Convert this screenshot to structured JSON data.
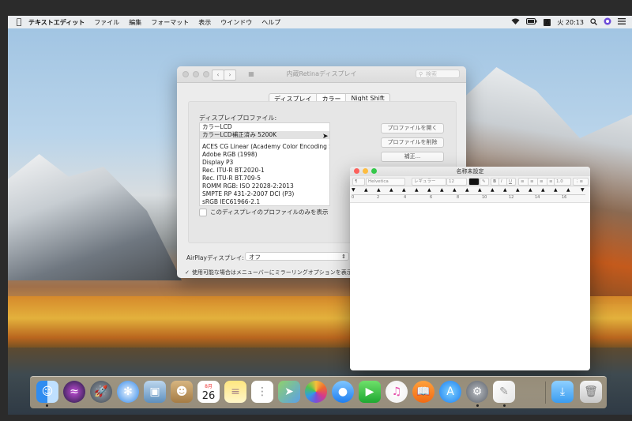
{
  "menubar": {
    "app_name": "テキストエディット",
    "items": [
      "ファイル",
      "編集",
      "フォーマット",
      "表示",
      "ウインドウ",
      "ヘルプ"
    ],
    "clock": "火 20:13",
    "input_indicator": "A"
  },
  "prefs_window": {
    "title": "内蔵Retinaディスプレイ",
    "search_placeholder": "検索",
    "tabs": [
      "ディスプレイ",
      "カラー",
      "Night Shift"
    ],
    "selected_tab": "カラー",
    "profile_label": "ディスプレイプロファイル:",
    "profiles": [
      "カラーLCD",
      "カラーLCD補正済み 5200K",
      "ACES CG Linear (Academy Color Encoding Sy...",
      "Adobe RGB (1998)",
      "Display P3",
      "Rec. ITU-R BT.2020-1",
      "Rec. ITU-R BT.709-5",
      "ROMM RGB: ISO 22028-2:2013",
      "SMPTE RP 431-2-2007 DCI (P3)",
      "sRGB IEC61966-2.1"
    ],
    "selected_profile": "カラーLCD補正済み 5200K",
    "buttons": {
      "open_profile": "プロファイルを開く",
      "delete_profile": "プロファイルを削除",
      "calibrate": "補正..."
    },
    "only_this_display_label": "このディスプレイのプロファイルのみを表示",
    "airplay_label": "AirPlayディスプレイ:",
    "airplay_value": "オフ",
    "mirror_label": "使用可能な場合はメニューバーにミラーリングオプションを表示",
    "mirror_checked": true
  },
  "textedit": {
    "title": "名称未設定",
    "font_family": "Helvetica",
    "font_style": "レギュラー",
    "font_size": "12",
    "line_spacing": "1.0",
    "ruler_numbers": [
      "0",
      "2",
      "4",
      "6",
      "8",
      "10",
      "12",
      "14",
      "16"
    ]
  },
  "dock": {
    "calendar_month": "8月",
    "calendar_day": "26",
    "apps": [
      "finder-icon",
      "siri-icon",
      "launchpad-icon",
      "safari-icon",
      "preview-icon",
      "contacts-icon",
      "calendar-icon",
      "notes-icon",
      "reminders-icon",
      "maps-icon",
      "photos-icon",
      "messages-icon",
      "facetime-icon",
      "itunes-icon",
      "ibooks-icon",
      "appstore-icon",
      "system-preferences-icon",
      "textedit-icon",
      "downloads-folder-icon",
      "trash-icon"
    ]
  }
}
